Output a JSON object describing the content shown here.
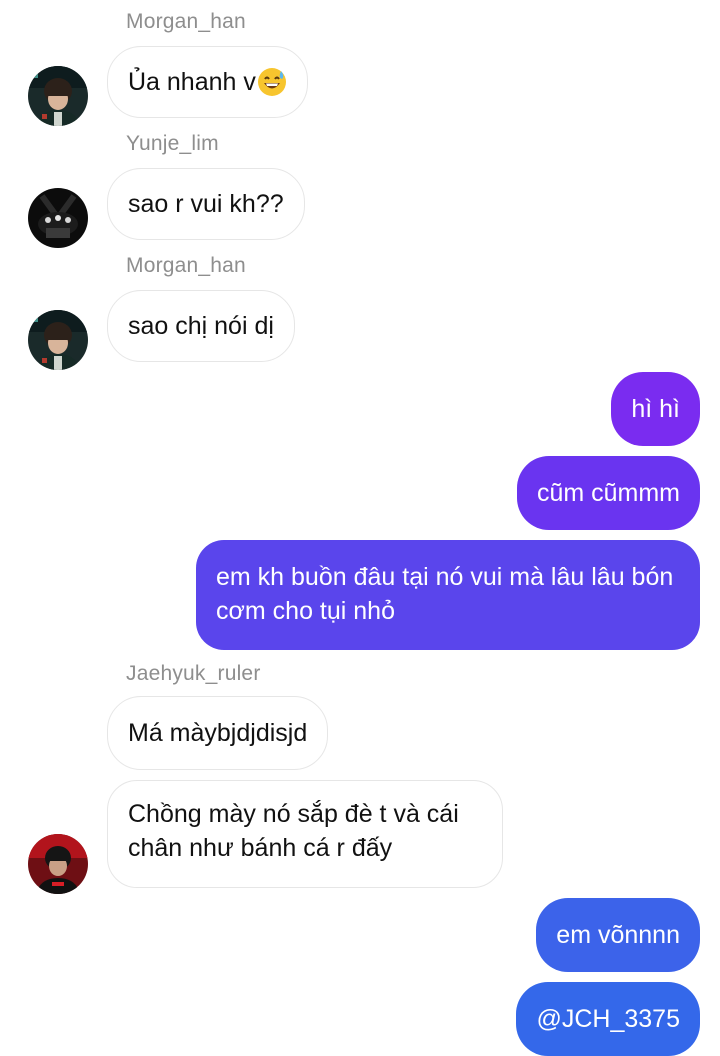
{
  "messages": [
    {
      "sender": "Morgan_han",
      "text": "Ủa nhanh v",
      "emoji": "grinning-sweat-emoji"
    },
    {
      "sender": "Yunje_lim",
      "text": "sao r vui kh??"
    },
    {
      "sender": "Morgan_han",
      "text": "sao chị nói dị"
    },
    {
      "text": "hì hì",
      "color": "#7a2cf0"
    },
    {
      "text": "cũm cũmmm",
      "color": "#6a34f0"
    },
    {
      "text": "em kh buồn đâu tại nó vui mà lâu lâu bón cơm cho tụi nhỏ",
      "color": "#5a45ec"
    },
    {
      "sender": "Jaehyuk_ruler",
      "text": "Má màybjdjdisjd"
    },
    {
      "text": "Chồng mày nó sắp đè t và cái chân như bánh cá r đấy"
    },
    {
      "text": "em võnnnn",
      "color": "#3c63ea"
    },
    {
      "text": "@JCH_3375",
      "color": "#3468ea"
    }
  ]
}
